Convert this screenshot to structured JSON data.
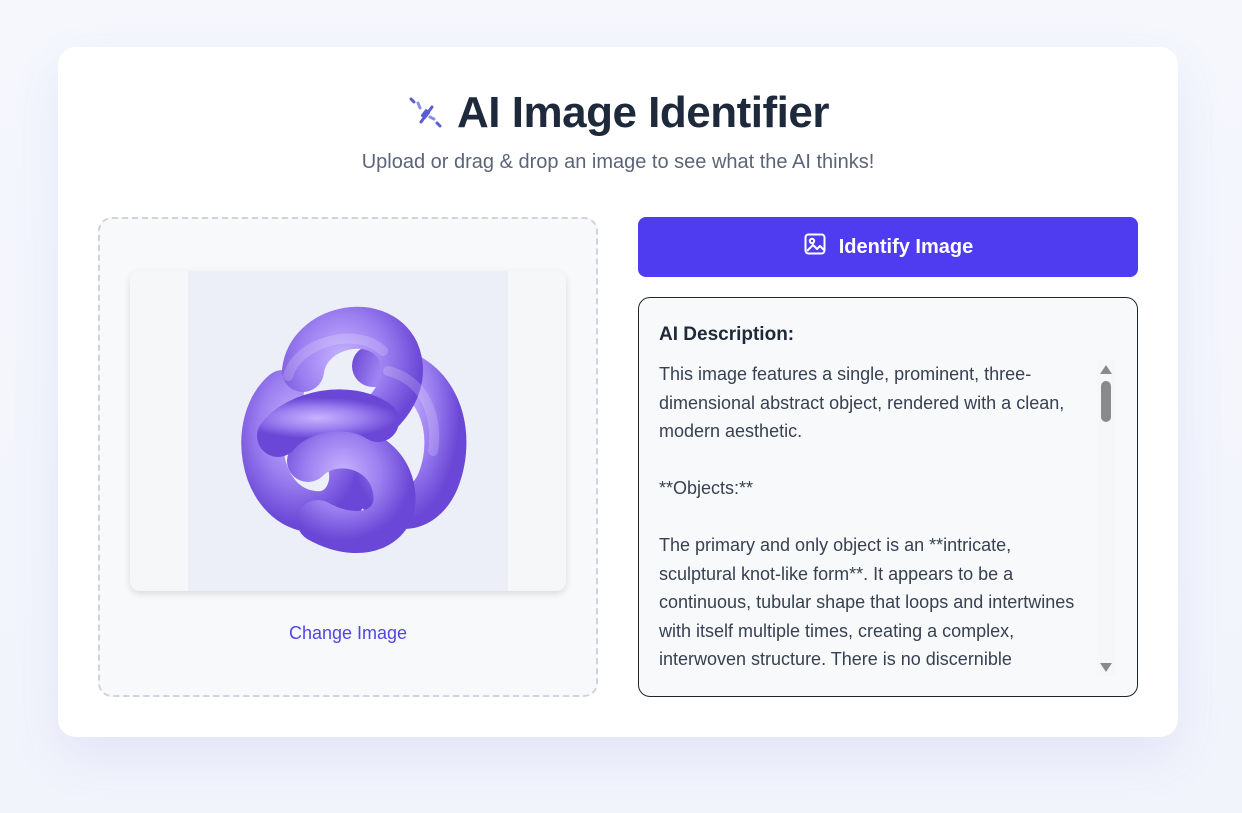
{
  "header": {
    "title": "AI Image Identifier",
    "subtitle": "Upload or drag & drop an image to see what the AI thinks!",
    "icon": "magic-wand-icon"
  },
  "upload": {
    "change_label": "Change Image",
    "preview_icon": "purple-knot-image"
  },
  "identify": {
    "label": "Identify Image",
    "icon": "image-icon"
  },
  "description": {
    "heading": "AI Description:",
    "text": "This image features a single, prominent, three-dimensional abstract object, rendered with a clean, modern aesthetic.\n\n**Objects:**\n\nThe primary and only object is an **intricate, sculptural knot-like form**. It appears to be a continuous, tubular shape that loops and intertwines with itself multiple times, creating a complex, interwoven structure. There is no discernible beginning or end to the \"tube,\""
  },
  "colors": {
    "accent": "#4f3cf0",
    "link": "#4f46e5",
    "title": "#1e293b",
    "knot": "#9b7ef0"
  }
}
